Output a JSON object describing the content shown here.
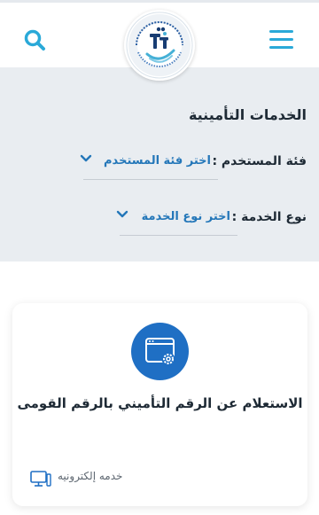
{
  "header": {
    "menu_icon": "hamburger-menu-icon",
    "search_icon": "search-icon",
    "logo_alt": "logo",
    "accent_color": "#2aa9d8",
    "logo_text": "الهيئة القومية للتأمين الاجتماعي National Organization for Social Insurance"
  },
  "filters": {
    "title": "الخدمات التأمينية",
    "user_category": {
      "label": "فئة المستخدم :",
      "value": "اختر فئة المستخدم"
    },
    "service_type": {
      "label": "نوع الخدمة :",
      "value": "اختر نوع الخدمة"
    }
  },
  "service_card": {
    "icon": "browser-settings-icon",
    "title": "الاستعلام عن الرقم التأميني بالرقم القومى",
    "type_label": "خدمه إلكترونيه",
    "type_icon": "desktop-computer-icon"
  },
  "colors": {
    "primary": "#1f6fc4",
    "link": "#2477b9",
    "panel_bg": "#e9edf1"
  }
}
